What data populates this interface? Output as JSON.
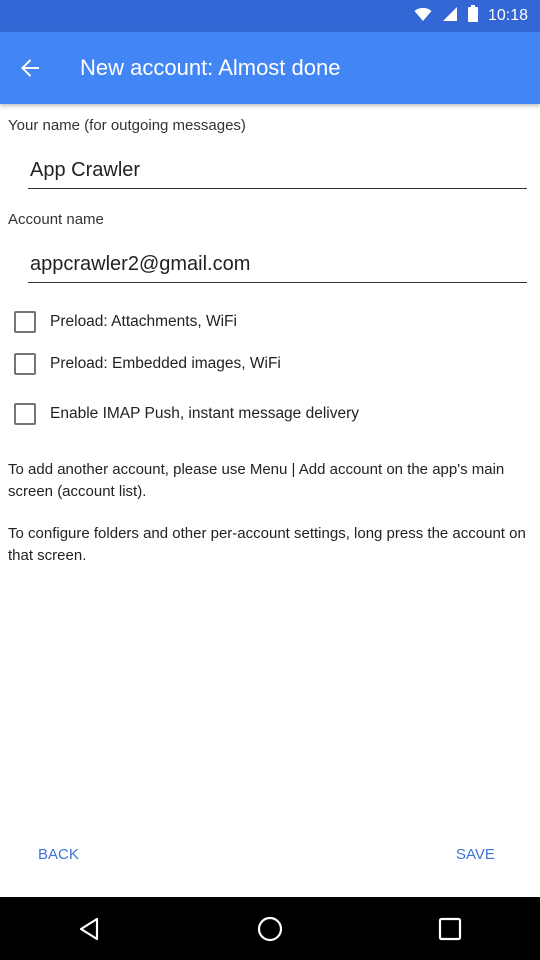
{
  "status_bar": {
    "time": "10:18"
  },
  "app_bar": {
    "title": "New account: Almost done"
  },
  "form": {
    "your_name_label": "Your name (for outgoing messages)",
    "your_name_value": "App Crawler",
    "account_name_label": "Account name",
    "account_name_value": "appcrawler2@gmail.com"
  },
  "checkboxes": [
    {
      "label": "Preload: Attachments, WiFi",
      "checked": false
    },
    {
      "label": "Preload: Embedded images, WiFi",
      "checked": false
    },
    {
      "label": "Enable IMAP Push, instant message delivery",
      "checked": false
    }
  ],
  "help": {
    "p1": "To add another account, please use Menu | Add account on the app's main screen (account list).",
    "p2": "To configure folders and other per-account settings, long press the account on that screen."
  },
  "footer": {
    "back_label": "BACK",
    "save_label": "SAVE"
  },
  "colors": {
    "status_bar": "#3367d6",
    "app_bar": "#4285f4",
    "accent_text": "#3f73d9"
  },
  "icons": [
    "wifi-icon",
    "signal-icon",
    "battery-icon",
    "back-arrow-icon",
    "nav-back-icon",
    "nav-home-icon",
    "nav-recents-icon"
  ]
}
